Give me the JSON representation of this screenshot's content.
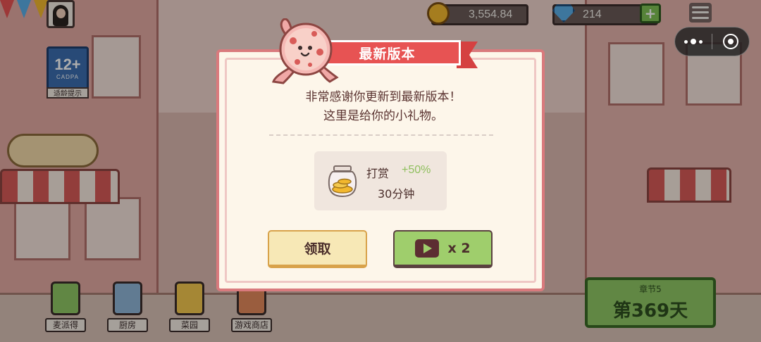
{
  "hud": {
    "coins": "3,554.84",
    "gems": "214",
    "plus_label": "+"
  },
  "age_rating": {
    "age": "12+",
    "org": "CADPA",
    "tip": "适龄提示"
  },
  "bottom_nav": [
    {
      "label": "麦派得"
    },
    {
      "label": "厨房"
    },
    {
      "label": "菜园"
    },
    {
      "label": "游戏商店"
    }
  ],
  "chapter": {
    "label": "章节5",
    "day": "第369天"
  },
  "dialog": {
    "title": "最新版本",
    "message_line1": "非常感谢你更新到最新版本！",
    "message_line2": "这里是给你的小礼物。",
    "reward": {
      "name": "打赏",
      "bonus": "+50%",
      "duration": "30分钟"
    },
    "claim_label": "领取",
    "video_label": "x 2"
  },
  "icons": {
    "coin": "coin-icon",
    "gem": "diamond-icon",
    "menu": "hamburger-menu-icon",
    "more": "more-dots-icon",
    "close": "circle-close-icon",
    "play": "video-play-icon",
    "jar": "coin-jar-icon"
  },
  "colors": {
    "ribbon": "#e75353",
    "modal_border": "#d97a7d",
    "claim_button": "#f7e8b6",
    "video_button": "#9fce6c",
    "bonus_text": "#8fbf5e"
  }
}
